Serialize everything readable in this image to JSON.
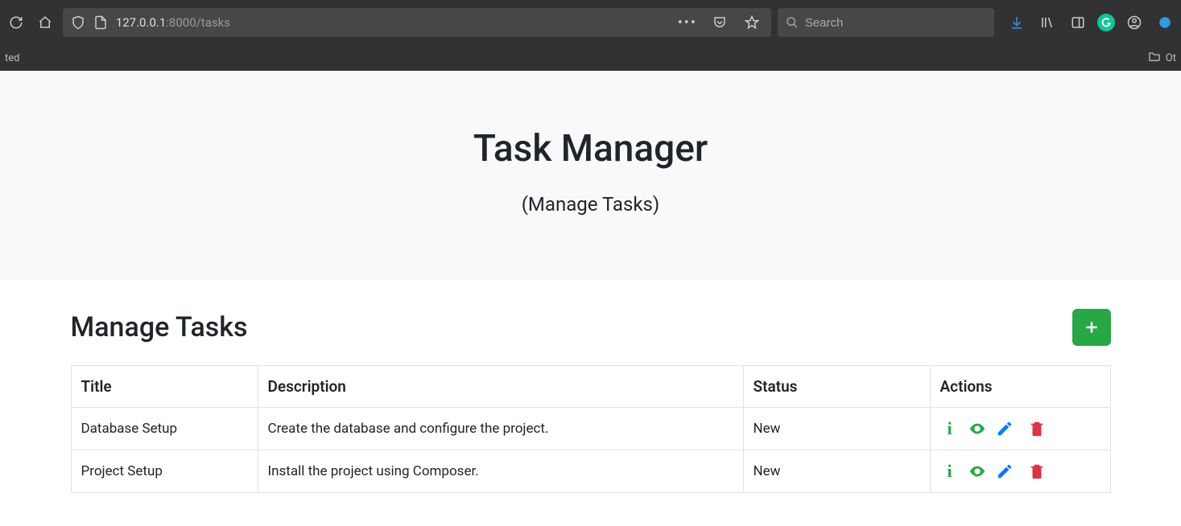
{
  "browser": {
    "url_display_prefix": "127.0.0.1",
    "url_display_suffix": ":8000/tasks",
    "search_placeholder": "Search",
    "bookmark_left": "ted",
    "bookmark_right": "Ot"
  },
  "hero": {
    "title": "Task Manager",
    "subtitle": "(Manage Tasks)"
  },
  "section": {
    "heading": "Manage Tasks"
  },
  "table": {
    "headers": {
      "title": "Title",
      "description": "Description",
      "status": "Status",
      "actions": "Actions"
    },
    "rows": [
      {
        "title": "Database Setup",
        "description": "Create the database and configure the project.",
        "status": "New"
      },
      {
        "title": "Project Setup",
        "description": "Install the project using Composer.",
        "status": "New"
      }
    ]
  }
}
